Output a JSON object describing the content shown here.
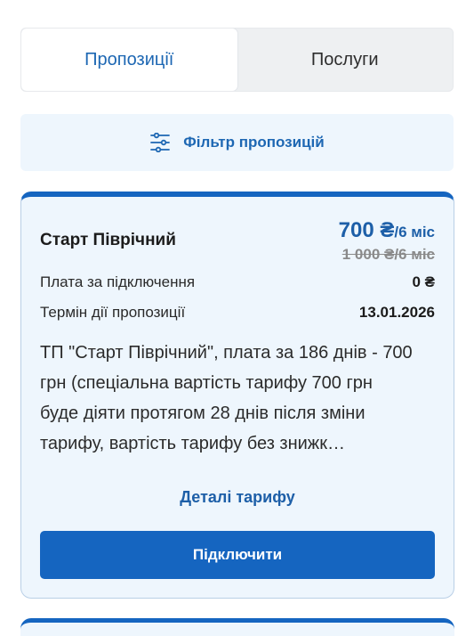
{
  "tabs": [
    {
      "label": "Пропозиції",
      "active": true
    },
    {
      "label": "Послуги",
      "active": false
    }
  ],
  "filter": {
    "label": "Фільтр пропозицій",
    "icon": "sliders-icon"
  },
  "offer": {
    "title": "Старт Піврічний",
    "price": "700 ₴",
    "price_period": "/6 міс",
    "old_price": "1 000 ₴/6 міс",
    "rows": [
      {
        "label": "Плата за підключення",
        "value": "0 ₴"
      },
      {
        "label": "Термін дії пропозиції",
        "value": "13.01.2026"
      }
    ],
    "description": "ТП \"Старт Піврічний\", плата за 186 днів - 700 грн (спеціальна вартість тарифу 700 грн буде діяти протягом 28 днів після зміни тарифу, вартість тарифу без знижк…",
    "details_label": "Деталі тарифу",
    "connect_label": "Підключити"
  },
  "colors": {
    "accent": "#1565c0",
    "link": "#1d67b3",
    "card_bg": "#eef6fd"
  }
}
